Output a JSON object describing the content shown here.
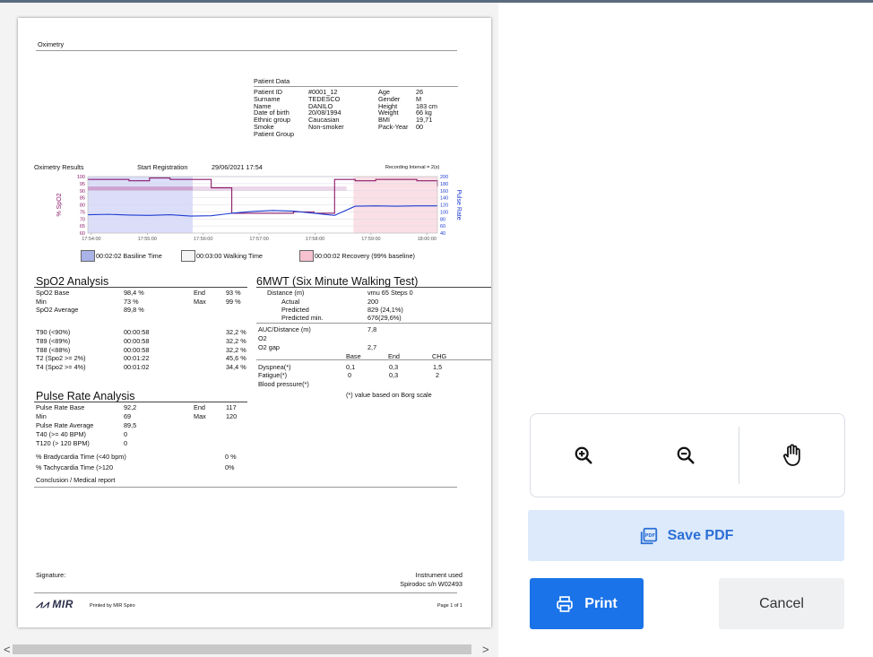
{
  "report": {
    "section_title": "Oximetry",
    "patient_data_title": "Patient Data",
    "patient_labels": [
      "Patient ID",
      "Surname",
      "Name",
      "Date of birth",
      "Ethnic group",
      "Smoke",
      "Patient Group"
    ],
    "patient_values": [
      "#0001_12",
      "TEDESCO",
      "DANILO",
      "20/08/1994",
      "Caucasian",
      "Non-smoker",
      ""
    ],
    "patient_labels2": [
      "Age",
      "Gender",
      "Height",
      "Weight",
      "BMI",
      "Pack-Year"
    ],
    "patient_values2": [
      "26",
      "M",
      "183 cm",
      "66 kg",
      "19,71",
      "00"
    ],
    "results_title": "Oximetry Results",
    "start_label": "Start Registration",
    "start_value": "29/06/2021 17:54",
    "interval": "Recording Interval = 2(s)",
    "legend": [
      "00:02:02  Basiline Time",
      "00:03:00  Walking Time",
      "00:00:02  Recovery (99% baseline)"
    ],
    "spo2": {
      "title": "SpO2 Analysis",
      "rows": [
        [
          "SpO2 Base",
          "98,4 %",
          "End",
          "93 %"
        ],
        [
          "Min",
          "73 %",
          "Max",
          "99 %"
        ],
        [
          "SpO2 Average",
          "89,8 %",
          "",
          ""
        ]
      ],
      "trows": [
        [
          "T90 (<90%)",
          "00:00:58",
          "32,2 %"
        ],
        [
          "T89 (<89%)",
          "00:00:58",
          "32,2 %"
        ],
        [
          "T88 (<88%)",
          "00:00:58",
          "32,2 %"
        ],
        [
          "T2 (Spo2 >= 2%)",
          "00:01:22",
          "45,6 %"
        ],
        [
          "T4 (Spo2 >= 4%)",
          "00:01:02",
          "34,4 %"
        ]
      ]
    },
    "mwt": {
      "title": "6MWT (Six Minute Walking Test)",
      "distance_label": "Distance (m)",
      "distance_value": "vmu  65    Steps 0",
      "actual_label": "Actual",
      "actual_value": "200",
      "predicted_label": "Predicted",
      "predicted_value": "829 (24,1%)",
      "predmin_label": "Predicted min.",
      "predmin_value": "676(29,6%)",
      "auc_label": "AUC/Distance (m)",
      "auc_value": "7,8",
      "o2_label": "O2",
      "o2gap_label": "O2 gap",
      "o2gap_value": "2,7",
      "col_base": "Base",
      "col_end": "End",
      "col_chg": "CHG",
      "dyspnea": [
        "Dyspnea(*)",
        "0,1",
        "0,3",
        "1,5"
      ],
      "fatigue": [
        "Fatigue(*)",
        "0",
        "0,3",
        "2"
      ],
      "bp_label": "Blood pressure(*)",
      "note": "(*) value based on Borg scale"
    },
    "pulse": {
      "title": "Pulse Rate Analysis",
      "rows": [
        [
          "Pulse Rate Base",
          "92,2",
          "End",
          "117"
        ],
        [
          "Min",
          "69",
          "Max",
          "120"
        ],
        [
          "Pulse Rate Average",
          "89,5",
          "",
          ""
        ],
        [
          "T40 (>= 40 BPM)",
          "0",
          "",
          ""
        ],
        [
          "T120 (> 120 BPM)",
          "0",
          "",
          ""
        ]
      ],
      "brady_label": "% Bradycardia Time (<40 bpm)",
      "brady_value": "0 %",
      "tachy_label": "% Tachycardia Time (>120",
      "tachy_value": "0%"
    },
    "conclusion": "Conclusion / Medical report",
    "signature": "Signature:",
    "instrument_label": "Instrument used",
    "instrument_value": "Spirodoc s/n W02493",
    "logo": "MIR",
    "printed_by": "Printed by MIR Spiro",
    "page_label": "Page 1 of 1"
  },
  "chart_data": {
    "type": "line",
    "x": [
      "17:54:00",
      "17:55:00",
      "17:56:00",
      "17:57:00",
      "17:58:00",
      "17:59:00",
      "18:00:00"
    ],
    "ylabel": "% SpO2",
    "y2label": "Pulse Rate",
    "ylim": [
      60,
      100
    ],
    "y2lim": [
      40,
      200
    ],
    "yticks": [
      "100",
      "95",
      "90",
      "85",
      "80",
      "75",
      "70",
      "65",
      "60"
    ],
    "y2ticks": [
      "200",
      "180",
      "160",
      "140",
      "120",
      "100",
      "80",
      "60",
      "40"
    ],
    "colors": {
      "spo2": "#8b1a6b",
      "pulse": "#1f3cd1",
      "baseline": "#b3b8f0",
      "walking": "#c78cc0",
      "recovery": "#f8d6dd"
    },
    "series": [
      {
        "name": "% SpO2",
        "values": [
          98,
          98,
          97,
          99,
          98,
          98,
          92,
          74,
          74,
          74,
          75,
          74,
          98,
          97,
          98,
          98,
          97,
          93
        ]
      },
      {
        "name": "Pulse Rate",
        "values": [
          92,
          93,
          91,
          90,
          92,
          88,
          89,
          96,
          101,
          104,
          102,
          96,
          90,
          116,
          117,
          116,
          117,
          117
        ]
      }
    ]
  },
  "toolbar": {
    "zoom_in_icon": "zoom-in-icon",
    "zoom_out_icon": "zoom-out-icon",
    "pan_icon": "hand-icon"
  },
  "buttons": {
    "save_pdf": "Save PDF",
    "print": "Print",
    "cancel": "Cancel"
  },
  "scroll": {
    "left": "<",
    "right": ">"
  }
}
